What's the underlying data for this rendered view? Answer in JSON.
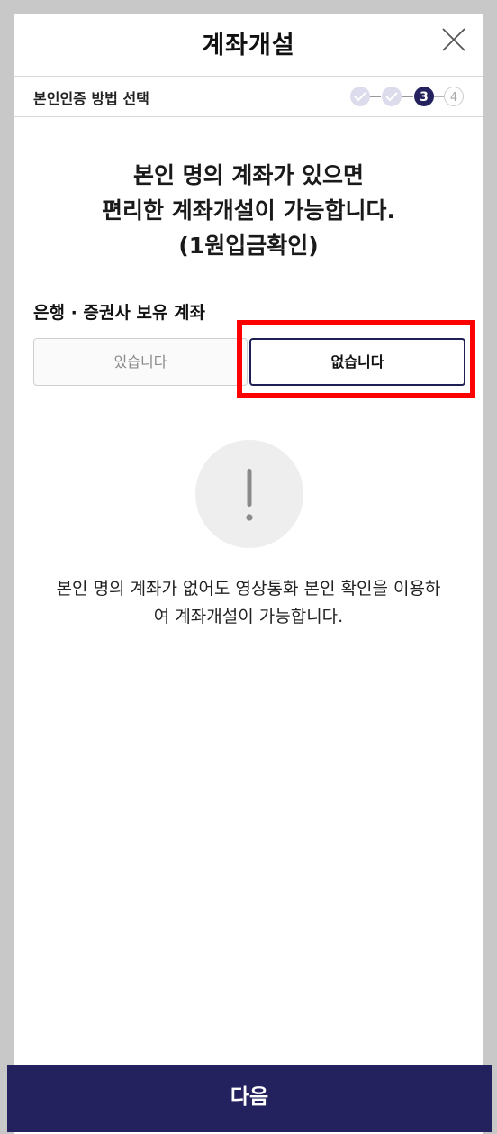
{
  "header": {
    "title": "계좌개설",
    "close_icon": "close-icon"
  },
  "stepbar": {
    "label": "본인인증 방법 선택",
    "steps": [
      {
        "state": "done",
        "icon": "check-icon"
      },
      {
        "state": "done",
        "icon": "check-icon"
      },
      {
        "state": "current",
        "number": "3"
      },
      {
        "state": "todo",
        "number": "4"
      }
    ]
  },
  "main": {
    "heading_lines": [
      "본인 명의 계좌가 있으면",
      "편리한 계좌개설이 가능합니다.",
      "(1원입금확인)"
    ],
    "group_label": "은행 · 증권사 보유 계좌",
    "options": {
      "yes": "있습니다",
      "no": "없습니다",
      "selected": "no"
    },
    "notice_icon": "exclamation-icon",
    "notice_lines": [
      "본인 명의 계좌가 없어도 영상통화 본인 확인을 이용하",
      "여 계좌개설이 가능합니다."
    ]
  },
  "footer": {
    "next_label": "다음"
  },
  "colors": {
    "accent": "#23225e",
    "highlight": "#ff0000",
    "done_step": "#dcdcec"
  }
}
